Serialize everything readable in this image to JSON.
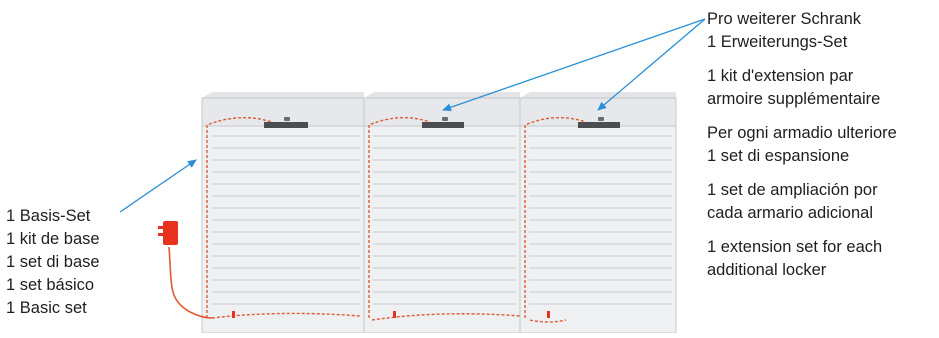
{
  "left_labels": [
    "1 Basis-Set",
    "1 kit de base",
    "1 set di base",
    "1 set básico",
    "1 Basic set"
  ],
  "right_labels": [
    [
      "Pro weiterer Schrank",
      "1 Erweiterungs-Set"
    ],
    [
      "1 kit d'extension par",
      "armoire supplémentaire"
    ],
    [
      "Per ogni armadio ulteriore",
      "1 set di espansione"
    ],
    [
      "1 set de ampliación por",
      "cada armario adicional"
    ],
    [
      "1 extension set for each",
      "additional locker"
    ]
  ],
  "colors": {
    "pointer": "#2a8fd6",
    "cable": "#e05a32",
    "power_supply": "#e8321e",
    "cabinet_body": "#eef0f2",
    "cabinet_top": "#e4e6e9",
    "drawer_line": "#c9ccd1",
    "lock_panel": "#4a4d52"
  },
  "icons": {
    "power_supply": "power-adapter-icon",
    "lock": "lock-panel-icon"
  }
}
